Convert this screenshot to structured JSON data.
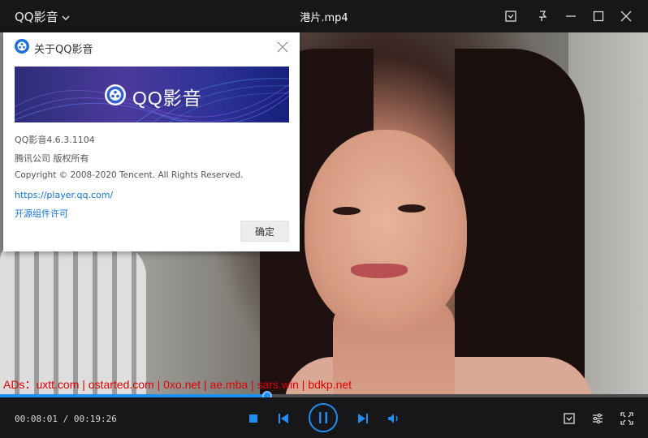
{
  "titlebar": {
    "app_menu_label": "QQ影音",
    "file_title": "港片.mp4"
  },
  "about_dialog": {
    "title": "关于QQ影音",
    "banner_text": "QQ影音",
    "version": "QQ影音4.6.3.1104",
    "rights": "腾讯公司 版权所有",
    "copyright": "Copyright © 2008-2020  Tencent. All Rights  Reserved.",
    "website_link": "https://player.qq.com/",
    "opensource_link": "开源组件许可",
    "ok_label": "确定"
  },
  "overlay": {
    "ads_text": "ADs：uxtt.com | ostarted.com | 0xo.net | ae.mba | sars.win | bdkp.net"
  },
  "playback": {
    "current_time": "00:08:01",
    "total_time": "00:19:26",
    "time_display": "00:08:01 / 00:19:26",
    "progress_fraction": 0.412
  },
  "colors": {
    "accent": "#1f8ef1",
    "titlebar_bg": "#17171a",
    "ads_red": "#e00000",
    "link_blue": "#1273d6"
  },
  "icons": {
    "titlebar": [
      "chevron-down-icon",
      "screenshot-icon",
      "pin-icon",
      "minimize-icon",
      "maximize-icon",
      "close-icon"
    ],
    "controls": [
      "stop-icon",
      "previous-icon",
      "pause-icon",
      "next-icon",
      "volume-icon",
      "screenshot-icon",
      "settings-icon",
      "fullscreen-icon"
    ]
  }
}
